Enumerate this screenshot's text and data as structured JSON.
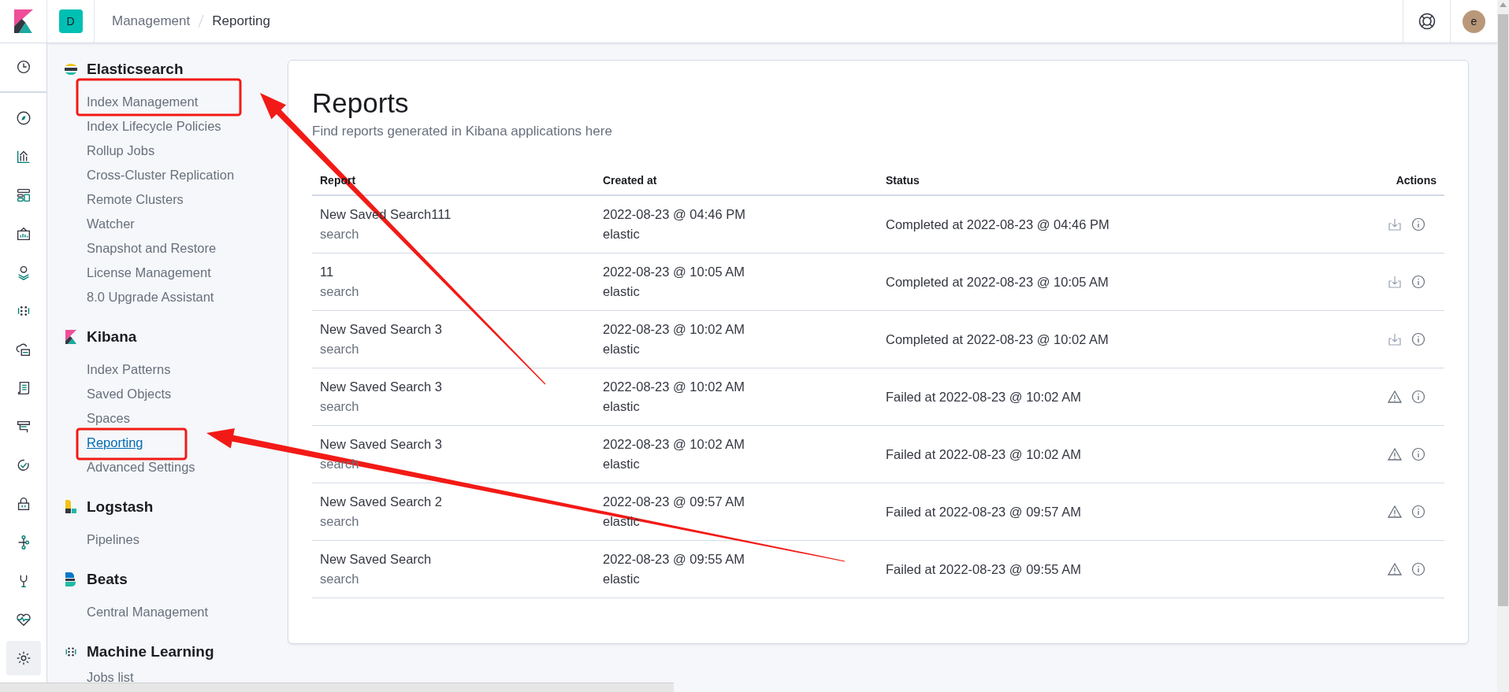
{
  "header": {
    "space_badge": "D",
    "breadcrumbs": [
      {
        "label": "Management",
        "selected": false
      },
      {
        "label": "Reporting",
        "selected": true
      }
    ],
    "avatar": "e"
  },
  "nav_rail": [
    {
      "selected": false
    },
    {
      "selected": false
    },
    {
      "selected": false
    },
    {
      "selected": false
    },
    {
      "selected": false
    },
    {
      "selected": false
    },
    {
      "selected": false
    },
    {
      "selected": false
    },
    {
      "selected": false
    },
    {
      "selected": false
    },
    {
      "selected": false
    },
    {
      "selected": false
    },
    {
      "selected": false
    },
    {
      "selected": false
    },
    {
      "selected": false
    },
    {
      "selected": true
    }
  ],
  "sidebar": [
    {
      "title": "Elasticsearch",
      "items": [
        {
          "label": "Index Management",
          "selected": false
        },
        {
          "label": "Index Lifecycle Policies",
          "selected": false
        },
        {
          "label": "Rollup Jobs",
          "selected": false
        },
        {
          "label": "Cross-Cluster Replication",
          "selected": false
        },
        {
          "label": "Remote Clusters",
          "selected": false
        },
        {
          "label": "Watcher",
          "selected": false
        },
        {
          "label": "Snapshot and Restore",
          "selected": false
        },
        {
          "label": "License Management",
          "selected": false
        },
        {
          "label": "8.0 Upgrade Assistant",
          "selected": false
        }
      ]
    },
    {
      "title": "Kibana",
      "items": [
        {
          "label": "Index Patterns",
          "selected": false
        },
        {
          "label": "Saved Objects",
          "selected": false
        },
        {
          "label": "Spaces",
          "selected": false
        },
        {
          "label": "Reporting",
          "selected": true
        },
        {
          "label": "Advanced Settings",
          "selected": false
        }
      ]
    },
    {
      "title": "Logstash",
      "items": [
        {
          "label": "Pipelines",
          "selected": false
        }
      ]
    },
    {
      "title": "Beats",
      "items": [
        {
          "label": "Central Management",
          "selected": false
        }
      ]
    },
    {
      "title": "Machine Learning",
      "items": [
        {
          "label": "Jobs list",
          "selected": false
        }
      ]
    }
  ],
  "page": {
    "title": "Reports",
    "subtitle": "Find reports generated in Kibana applications here"
  },
  "table": {
    "columns": [
      "Report",
      "Created at",
      "Status",
      "Actions"
    ],
    "rows": [
      {
        "report": "New Saved Search111",
        "type": "search",
        "created": "2022-08-23 @ 04:46 PM",
        "user": "elastic",
        "status": "Completed at 2022-08-23 @ 04:46 PM",
        "kind": "completed"
      },
      {
        "report": "11",
        "type": "search",
        "created": "2022-08-23 @ 10:05 AM",
        "user": "elastic",
        "status": "Completed at 2022-08-23 @ 10:05 AM",
        "kind": "completed"
      },
      {
        "report": "New Saved Search 3",
        "type": "search",
        "created": "2022-08-23 @ 10:02 AM",
        "user": "elastic",
        "status": "Completed at 2022-08-23 @ 10:02 AM",
        "kind": "completed"
      },
      {
        "report": "New Saved Search 3",
        "type": "search",
        "created": "2022-08-23 @ 10:02 AM",
        "user": "elastic",
        "status": "Failed at 2022-08-23 @ 10:02 AM",
        "kind": "failed"
      },
      {
        "report": "New Saved Search 3",
        "type": "search",
        "created": "2022-08-23 @ 10:02 AM",
        "user": "elastic",
        "status": "Failed at 2022-08-23 @ 10:02 AM",
        "kind": "failed"
      },
      {
        "report": "New Saved Search 2",
        "type": "search",
        "created": "2022-08-23 @ 09:57 AM",
        "user": "elastic",
        "status": "Failed at 2022-08-23 @ 09:57 AM",
        "kind": "failed"
      },
      {
        "report": "New Saved Search",
        "type": "search",
        "created": "2022-08-23 @ 09:55 AM",
        "user": "elastic",
        "status": "Failed at 2022-08-23 @ 09:55 AM",
        "kind": "failed"
      }
    ]
  }
}
